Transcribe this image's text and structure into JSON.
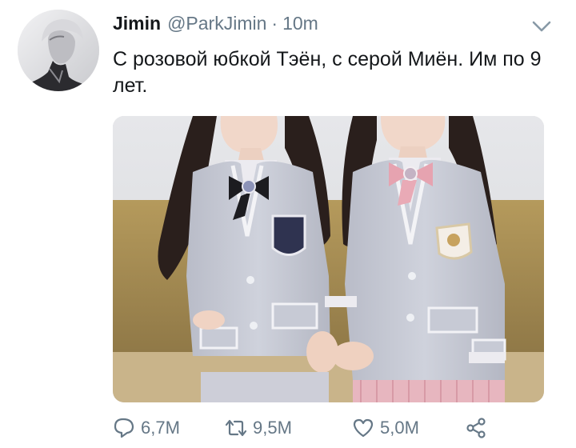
{
  "tweet": {
    "display_name": "Jimin",
    "handle": "@ParkJimin",
    "separator": "·",
    "timestamp": "10m",
    "text": "С розовой юбкой Тэён, с серой Миён. Им по 9 лет."
  },
  "actions": {
    "reply_count": "6,7M",
    "retweet_count": "9,5M",
    "like_count": "5,0M"
  },
  "colors": {
    "text_primary": "#14171a",
    "text_secondary": "#657786",
    "icon": "#657786"
  },
  "icons": [
    "reply-icon",
    "retweet-icon",
    "like-icon",
    "share-icon",
    "chevron-down-icon"
  ]
}
